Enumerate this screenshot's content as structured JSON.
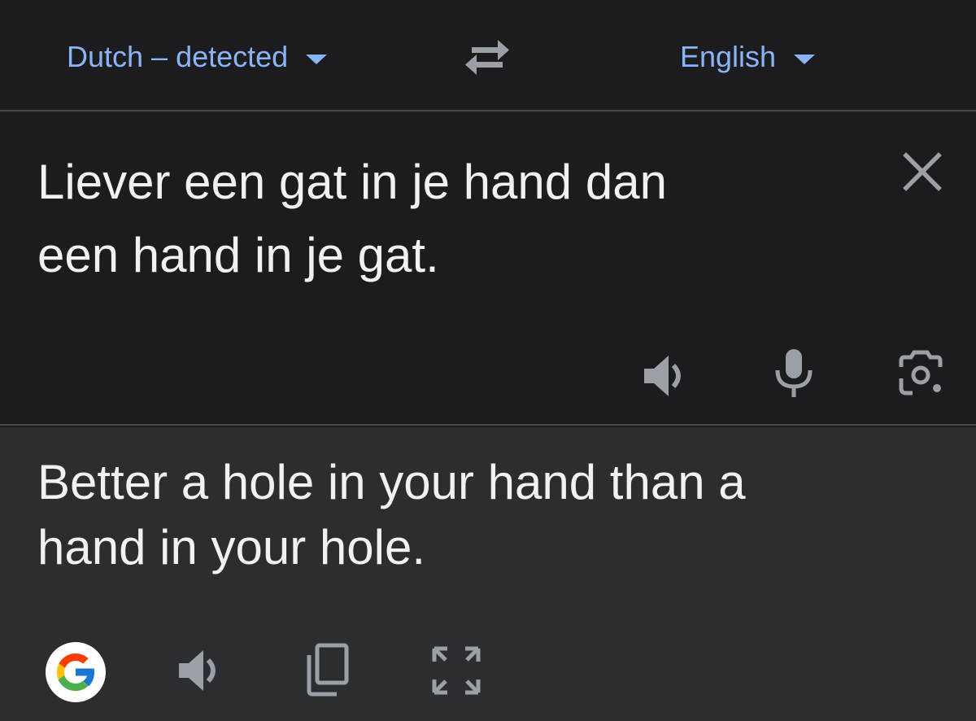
{
  "languages": {
    "source_label": "Dutch – detected",
    "target_label": "English"
  },
  "source": {
    "text_line1": "Liever een gat in je hand dan",
    "text_line2": "een hand in je gat."
  },
  "result": {
    "text_line1": "Better a hole in your hand than a",
    "text_line2": "hand in your hole."
  },
  "icons": {
    "swap": "swap-arrows-icon",
    "clear": "close-icon",
    "listen": "speaker-icon",
    "mic": "microphone-icon",
    "camera": "camera-icon",
    "google": "google-logo-icon",
    "copy": "copy-icon",
    "fullscreen": "fullscreen-icon"
  },
  "colors": {
    "accent": "#8ab4f8",
    "background": "#1c1c1e",
    "result_background": "#2c2d31",
    "text": "#f1f1f3",
    "icon": "#9aa0a6"
  }
}
